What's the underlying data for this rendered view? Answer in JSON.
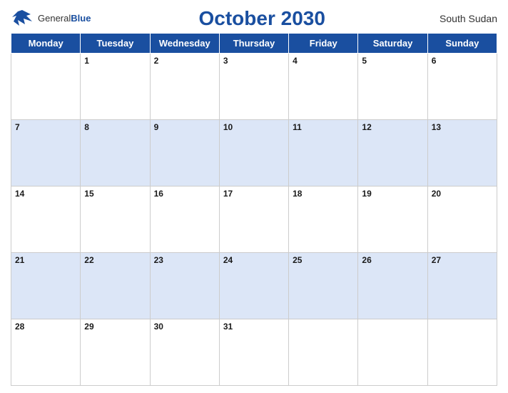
{
  "header": {
    "title": "October 2030",
    "country": "South Sudan",
    "logo_general": "General",
    "logo_blue": "Blue"
  },
  "weekdays": [
    "Monday",
    "Tuesday",
    "Wednesday",
    "Thursday",
    "Friday",
    "Saturday",
    "Sunday"
  ],
  "weeks": [
    [
      null,
      1,
      2,
      3,
      4,
      5,
      6
    ],
    [
      7,
      8,
      9,
      10,
      11,
      12,
      13
    ],
    [
      14,
      15,
      16,
      17,
      18,
      19,
      20
    ],
    [
      21,
      22,
      23,
      24,
      25,
      26,
      27
    ],
    [
      28,
      29,
      30,
      31,
      null,
      null,
      null
    ]
  ]
}
